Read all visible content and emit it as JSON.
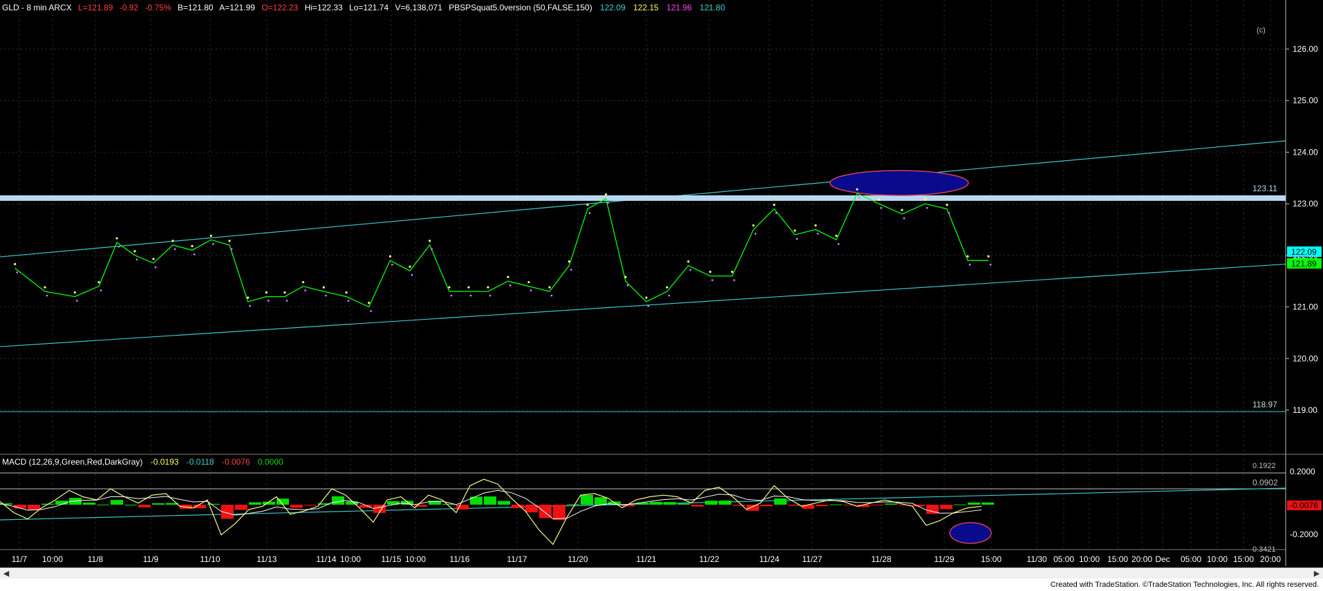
{
  "header": {
    "symbol": "GLD - 8 min  ARCX",
    "last": "L=121.89",
    "chg": "-0.92",
    "pct": "-0.75%",
    "bid": "B=121.80",
    "ask": "A=121.99",
    "open": "O=122.23",
    "hi": "Hi=122.33",
    "lo": "Lo=121.74",
    "vol": "V=6,138,071",
    "study": "PBSPSquat5.0version (50,FALSE,150)",
    "v1": "122.09",
    "v2": "122.15",
    "v3": "121.96",
    "v4": "121.80",
    "copyright_mark": "(c)"
  },
  "macd_header": {
    "label": "MACD (12,26,9,Green,Red,DarkGray)",
    "v1": "-0.0193",
    "v2": "-0.0118",
    "v3": "-0.0076",
    "v4": "0.0000"
  },
  "colors": {
    "bg": "#000000",
    "price": "#00ff00",
    "channel": "#3cc8c8",
    "resistance_band": "#b8d8f0",
    "ellipse_fill": "#0a0a8c",
    "ellipse_stroke": "#d04060",
    "macd_pos": "#00dd00",
    "macd_neg": "#ee1111",
    "macd_line": "#ffff80",
    "signal_line": "#ffffff"
  },
  "price_labels": {
    "resistance": "123.11",
    "support": "118.97",
    "last_box_1": "122.09",
    "last_box_2": "121.89"
  },
  "macd_labels": {
    "top_cut": "0.1922",
    "level": "0.0902",
    "last_box": "-0.0076",
    "bottom_cut": "0.3421"
  },
  "chart_data": {
    "type": "line",
    "title": "GLD - 8 min ARCX",
    "y_axis": {
      "ticks": [
        "126.00",
        "125.00",
        "124.00",
        "123.00",
        "122.00",
        "121.00",
        "120.00",
        "119.00"
      ],
      "ylim": [
        118.3,
        126.4
      ]
    },
    "x_axis": {
      "labels": [
        "11/7",
        "10:00",
        "11/8",
        "11/9",
        "11/10",
        "11/13",
        "11/14",
        "10:00",
        "11/15",
        "10:00",
        "11/16",
        "11/17",
        "11/20",
        "11/21",
        "11/22",
        "11/24",
        "11/27",
        "11/28",
        "11/29",
        "15:00",
        "11/30",
        "05:00",
        "10:00",
        "15:00",
        "20:00",
        "Dec",
        "05:00",
        "10:00",
        "15:00",
        "20:00"
      ]
    },
    "series": [
      {
        "x": [
          "11/7",
          "11/7",
          "11/7",
          "11/8",
          "11/8",
          "11/8",
          "11/9",
          "11/9",
          "11/9",
          "11/10",
          "11/10",
          "11/10",
          "11/13",
          "11/13",
          "11/13",
          "11/14",
          "11/14",
          "11/14",
          "11/15",
          "11/15",
          "11/15",
          "11/16",
          "11/16",
          "11/16",
          "11/17",
          "11/17",
          "11/17",
          "11/20",
          "11/20",
          "11/20",
          "11/21",
          "11/21",
          "11/21",
          "11/22",
          "11/22",
          "11/22",
          "11/24",
          "11/24",
          "11/24",
          "11/27",
          "11/27",
          "11/27",
          "11/28",
          "11/28",
          "11/28",
          "11/29",
          "11/29",
          "11/29"
        ],
        "values": [
          121.75,
          121.3,
          121.2,
          121.4,
          122.25,
          122.0,
          121.85,
          122.2,
          122.1,
          122.3,
          122.2,
          121.1,
          121.2,
          121.2,
          121.4,
          121.3,
          121.2,
          121.0,
          121.9,
          121.7,
          122.2,
          121.3,
          121.3,
          121.3,
          121.5,
          121.4,
          121.3,
          121.8,
          122.9,
          123.1,
          121.5,
          121.1,
          121.3,
          121.8,
          121.6,
          121.6,
          122.5,
          122.9,
          122.4,
          122.5,
          122.3,
          123.2,
          123.0,
          122.8,
          123.0,
          122.9,
          121.9,
          121.9
        ]
      }
    ],
    "channel_upper": {
      "x": [
        "11/7",
        "Dec"
      ],
      "y": [
        121.97,
        124.22
      ]
    },
    "channel_lower": {
      "x": [
        "11/7",
        "Dec"
      ],
      "y": [
        120.23,
        121.83
      ]
    },
    "horizontal_levels": [
      123.11,
      118.97
    ],
    "macd": {
      "y_ticks": [
        "0.2000",
        "-0.2000"
      ],
      "ylim": [
        -0.36,
        0.21
      ],
      "level_line": 0.0902,
      "values": [
        0.02,
        -0.05,
        -0.09,
        -0.02,
        0.03,
        0.09,
        0.05,
        0.03,
        0.1,
        0.05,
        0.01,
        0.06,
        0.07,
        -0.01,
        -0.02,
        0.03,
        -0.19,
        -0.12,
        -0.03,
        -0.01,
        0.05,
        -0.06,
        -0.04,
        -0.01,
        0.1,
        0.06,
        -0.02,
        -0.11,
        0.03,
        0.05,
        -0.02,
        0.06,
        0.03,
        -0.05,
        0.12,
        0.16,
        0.13,
        0.04,
        -0.04,
        -0.16,
        -0.25,
        -0.08,
        0.06,
        0.07,
        0.04,
        -0.02,
        0.03,
        0.05,
        0.06,
        0.05,
        0.01,
        0.09,
        0.11,
        0.05,
        -0.03,
        0.01,
        0.12,
        0.04,
        -0.01,
        0.01,
        0.03,
        0.02,
        -0.01,
        0.01,
        0.03,
        0.01,
        -0.01,
        -0.13,
        -0.1,
        -0.05,
        -0.02,
        -0.01
      ]
    }
  }
}
